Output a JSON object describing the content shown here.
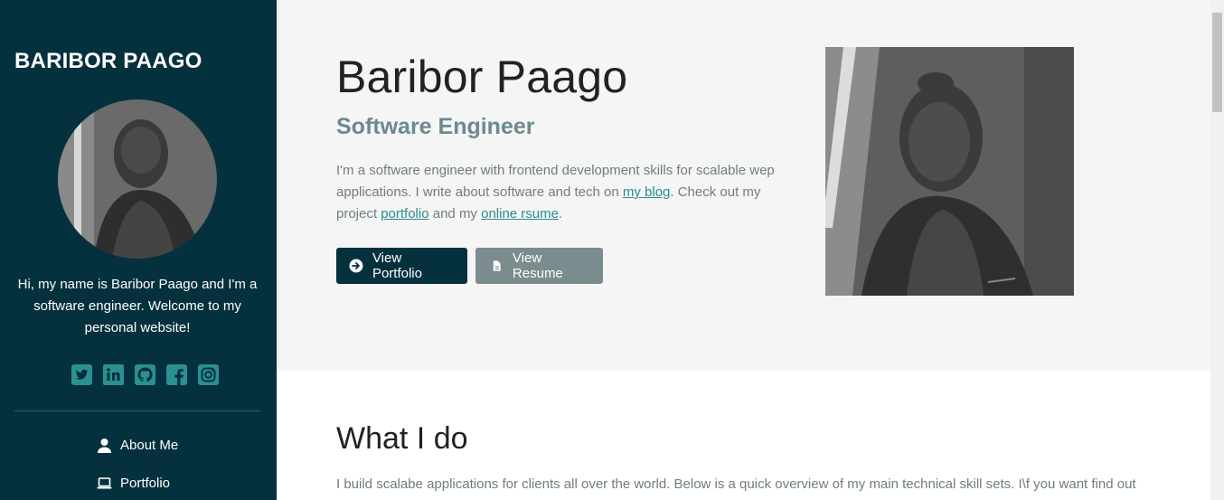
{
  "sidebar": {
    "brand": "BARIBOR PAAGO",
    "intro": "Hi, my name is Baribor Paago and I'm a software engineer. Welcome to my personal website!",
    "social": [
      "twitter-icon",
      "linkedin-icon",
      "github-icon",
      "facebook-icon",
      "instagram-icon"
    ],
    "nav": [
      {
        "label": "About Me",
        "icon": "user-icon"
      },
      {
        "label": "Portfolio",
        "icon": "laptop-icon"
      }
    ]
  },
  "hero": {
    "name": "Baribor Paago",
    "role": "Software Engineer",
    "bio_part1": "I'm a software engineer with frontend development skills for scalable wep applications. I write about software and tech on ",
    "blog_link": "my blog",
    "bio_part2": ". Check out my project ",
    "portfolio_link": "portfolio",
    "bio_part3": " and my ",
    "resume_link": "online rsume",
    "bio_part4": ".",
    "btn_portfolio": "View Portfolio",
    "btn_resume": "View Resume"
  },
  "section": {
    "title": "What I do",
    "text": "I build scalabe applications for clients all over the world. Below is a quick overview of my main technical skill sets. I\\f you want find out"
  },
  "colors": {
    "sidebar_bg": "#05313e",
    "accent": "#2a8c8c",
    "secondary_button": "#7b8c8f"
  }
}
